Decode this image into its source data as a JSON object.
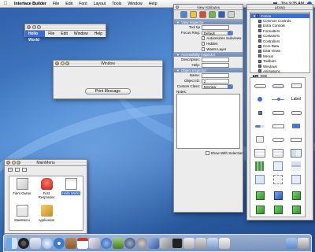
{
  "menubar": {
    "app": "Interface Builder",
    "items": [
      "File",
      "Edit",
      "Font",
      "Layout",
      "Tools",
      "Window",
      "Help"
    ],
    "clock": "Thu 9:35 AM"
  },
  "menu_window": {
    "title": "",
    "items": [
      "Hello World",
      "File",
      "Edit",
      "Window",
      "Help"
    ]
  },
  "message_window": {
    "title": "Window",
    "button_label": "Print Message"
  },
  "inspector": {
    "title": "View Attributes",
    "sections": {
      "view": "View Inspector",
      "accessibility": "Accessibility Inspector",
      "object": "Object Inspector"
    },
    "view_fields": {
      "tool_tip": "Tool tip",
      "focus_ring": "Focus Ring:",
      "focus_ring_value": "Default",
      "autoresizes": "Autoresizes Subviews",
      "hidden": "Hidden",
      "wants_layer": "Wants Layer"
    },
    "accessibility_fields": {
      "description": "Description:",
      "help": "Help:"
    },
    "object_fields": {
      "name": "Name:",
      "object_id": "Object ID:",
      "object_id_value": "2",
      "custom_class": "Custom Class:",
      "custom_class_value": "NSView"
    },
    "notes_label": "Notes:",
    "show_with_selection": "Show With Selection"
  },
  "library": {
    "title": "Library",
    "tree": [
      {
        "label": "Cocoa",
        "level": 0,
        "selected": true
      },
      {
        "label": "Common Controls",
        "level": 1
      },
      {
        "label": "Extra Controls",
        "level": 1
      },
      {
        "label": "Formatters",
        "level": 1
      },
      {
        "label": "Containers",
        "level": 1
      },
      {
        "label": "Controllers",
        "level": 1
      },
      {
        "label": "Core Data",
        "level": 1
      },
      {
        "label": "Data Views",
        "level": 1
      },
      {
        "label": "Menus",
        "level": 1
      },
      {
        "label": "Toolbars",
        "level": 1
      },
      {
        "label": "Windows",
        "level": 1
      },
      {
        "label": "Animations",
        "level": 1
      },
      {
        "label": "SDK",
        "level": 0
      },
      {
        "label": "Library",
        "level": 0
      }
    ],
    "label_item": "Label"
  },
  "document_window": {
    "title": "MainMenu",
    "items": [
      "File's Owner",
      "First Responder",
      "Hello World",
      "MainMenu",
      "Application"
    ]
  },
  "dock": {
    "apps": [
      "finder",
      "dashboard",
      "mail",
      "ichat",
      "safari",
      "address-book",
      "ical",
      "preview",
      "itunes",
      "iphoto",
      "quicktime",
      "system-preferences",
      "xcode",
      "interface-builder",
      "terminal",
      "trash"
    ]
  }
}
